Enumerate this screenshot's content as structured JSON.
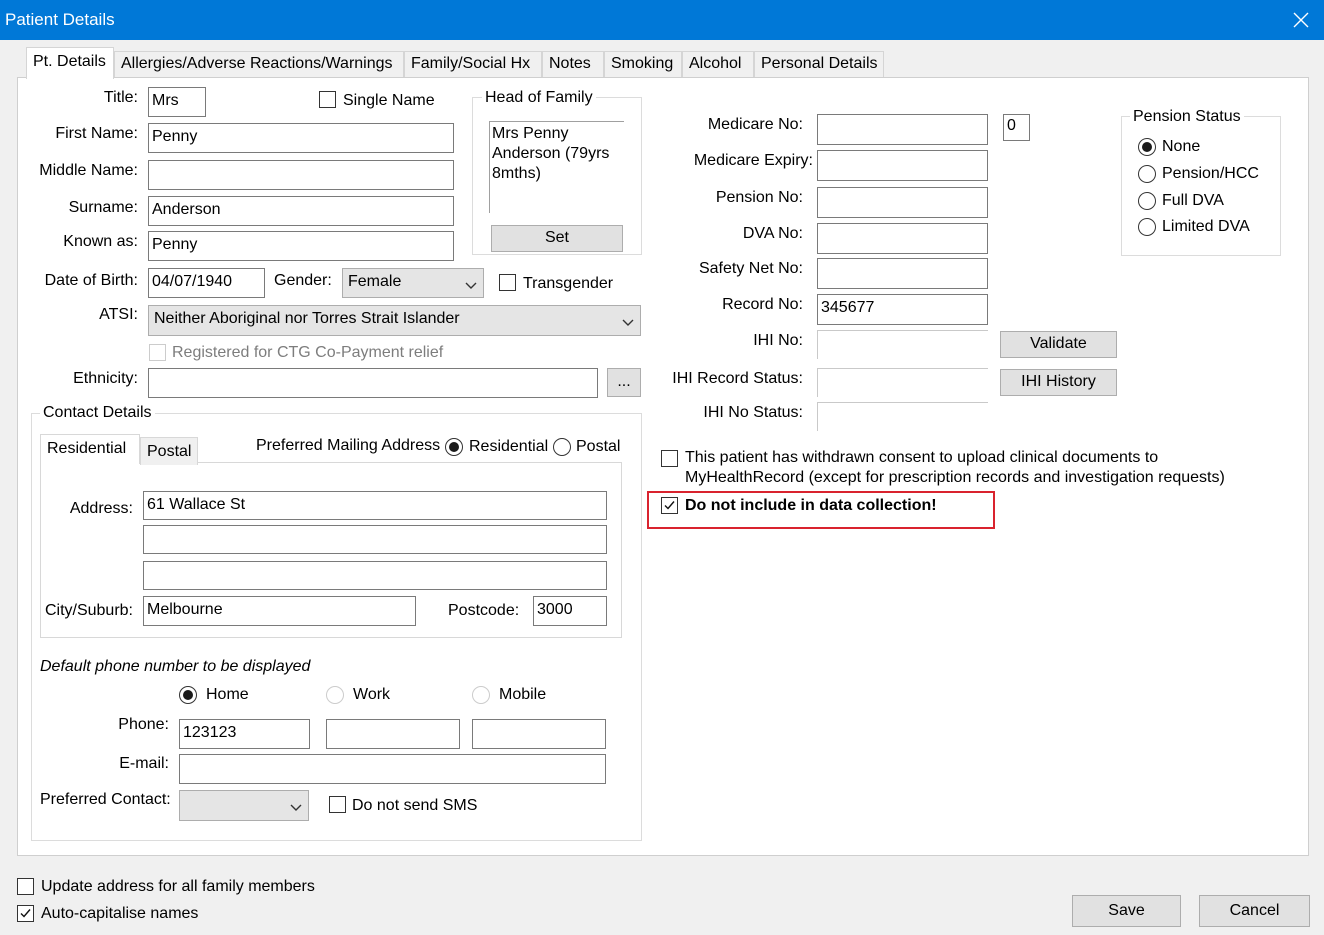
{
  "window": {
    "title": "Patient Details"
  },
  "tabs": [
    {
      "label": "Pt. Details"
    },
    {
      "label": "Allergies/Adverse Reactions/Warnings"
    },
    {
      "label": "Family/Social Hx"
    },
    {
      "label": "Notes"
    },
    {
      "label": "Smoking"
    },
    {
      "label": "Alcohol"
    },
    {
      "label": "Personal Details"
    }
  ],
  "patient": {
    "title_label": "Title:",
    "title_value": "Mrs",
    "single_name_label": "Single Name",
    "first_name_label": "First Name:",
    "first_name": "Penny",
    "middle_name_label": "Middle Name:",
    "middle_name": "",
    "surname_label": "Surname:",
    "surname": "Anderson",
    "known_as_label": "Known as:",
    "known_as": "Penny",
    "dob_label": "Date of Birth:",
    "dob": "04/07/1940",
    "gender_label": "Gender:",
    "gender": "Female",
    "transgender_label": "Transgender",
    "atsi_label": "ATSI:",
    "atsi": "Neither Aboriginal nor Torres Strait Islander",
    "ctg_label": "Registered for CTG Co-Payment relief",
    "ethnicity_label": "Ethnicity:",
    "ethnicity": "",
    "ethnicity_button": "..."
  },
  "head_of_family": {
    "title": "Head of Family",
    "lines": [
      "Mrs Penny",
      "Anderson (79yrs",
      "8mths)"
    ],
    "set_button": "Set"
  },
  "contact": {
    "group_title": "Contact Details",
    "subtabs": [
      "Residential",
      "Postal"
    ],
    "preferred_mailing_label": "Preferred Mailing Address",
    "mailing_options": [
      "Residential",
      "Postal"
    ],
    "address_label": "Address:",
    "address_lines": [
      "61 Wallace St",
      "",
      ""
    ],
    "city_label": "City/Suburb:",
    "city": "Melbourne",
    "postcode_label": "Postcode:",
    "postcode": "3000",
    "default_phone_label": "Default phone number to be displayed",
    "phone_options": [
      "Home",
      "Work",
      "Mobile"
    ],
    "phone_label": "Phone:",
    "phone_home": "123123",
    "phone_work": "",
    "phone_mobile": "",
    "email_label": "E-mail:",
    "email": "",
    "preferred_contact_label": "Preferred Contact:",
    "preferred_contact": "",
    "do_not_send_sms_label": "Do not send SMS"
  },
  "medicare": {
    "medicare_no_label": "Medicare No:",
    "medicare_no": "",
    "irn": "0",
    "medicare_expiry_label": "Medicare Expiry:",
    "medicare_expiry": "",
    "pension_no_label": "Pension No:",
    "pension_no": "",
    "dva_no_label": "DVA No:",
    "dva_no": "",
    "safety_net_label": "Safety Net No:",
    "safety_net": "",
    "record_no_label": "Record No:",
    "record_no": "345677",
    "ihi_no_label": "IHI No:",
    "ihi_no": "",
    "ihi_record_status_label": "IHI Record Status:",
    "ihi_record_status": "",
    "ihi_no_status_label": "IHI No Status:",
    "ihi_no_status": "",
    "validate_button": "Validate",
    "ihi_history_button": "IHI History"
  },
  "pension_status": {
    "title": "Pension Status",
    "options": [
      "None",
      "Pension/HCC",
      "Full DVA",
      "Limited DVA"
    ]
  },
  "consent": {
    "line1": "This patient has withdrawn consent to upload clinical documents to",
    "line2": "MyHealthRecord (except for prescription records and investigation requests)"
  },
  "data_collection": {
    "label": "Do not include in data collection!"
  },
  "footer": {
    "update_address_label": "Update address for all family members",
    "auto_capitalise_label": "Auto-capitalise names",
    "save_button": "Save",
    "cancel_button": "Cancel"
  }
}
